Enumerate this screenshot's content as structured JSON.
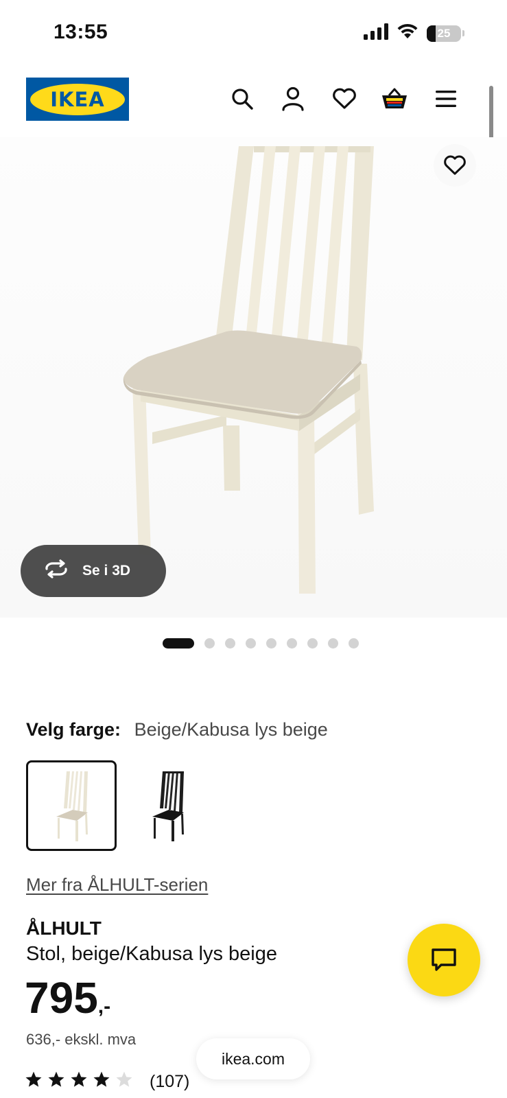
{
  "status_bar": {
    "time": "13:55",
    "battery_level": "25",
    "icons": [
      "cellular-signal-icon",
      "wifi-icon",
      "battery-icon"
    ]
  },
  "header": {
    "logo_text": "IKEA",
    "brand_colors": {
      "blue": "#0058a3",
      "yellow": "#ffda1a"
    },
    "icons": [
      "search-icon",
      "account-icon",
      "heart-icon",
      "basket-icon",
      "menu-icon"
    ]
  },
  "gallery": {
    "view_3d_label": "Se i 3D",
    "image_count": 9,
    "active_index": 0,
    "favourite_icon": "heart-icon"
  },
  "color_picker": {
    "label": "Velg farge:",
    "selected_value": "Beige/Kabusa lys beige",
    "options": [
      "beige-chair-swatch",
      "black-chair-swatch"
    ],
    "selected_index": 0
  },
  "product": {
    "series_link": "Mer fra ÅLHULT-serien",
    "name": "ÅLHULT",
    "description": "Stol, beige/Kabusa lys beige",
    "price_integer": "795",
    "price_suffix": ",-",
    "price_ex_vat": "636,- ekskl. mva",
    "rating": 4,
    "rating_max": 5,
    "review_count": "(107)"
  },
  "chat": {
    "icon": "chat-icon",
    "color": "#fbd914"
  },
  "browser": {
    "url": "ikea.com"
  }
}
